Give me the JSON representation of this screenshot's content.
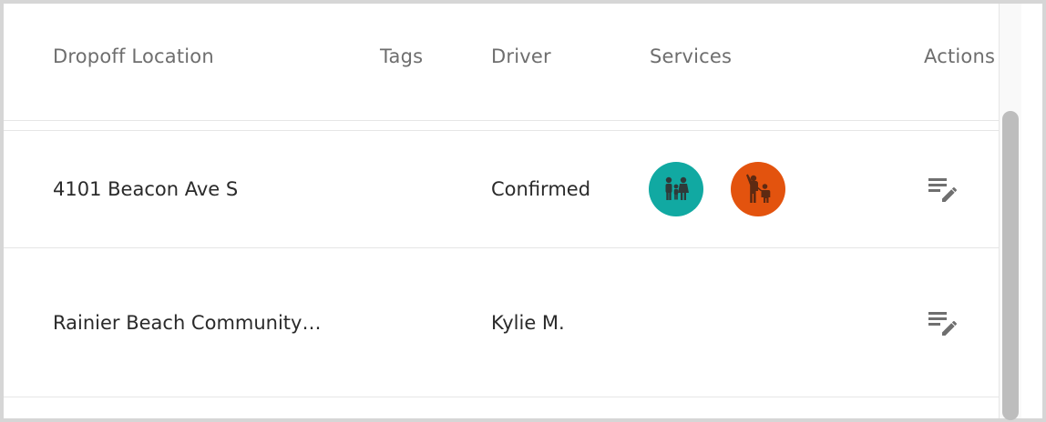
{
  "columns": {
    "dropoff": "Dropoff Location",
    "tags": "Tags",
    "driver": "Driver",
    "services": "Services",
    "actions": "Actions"
  },
  "rows": [
    {
      "dropoff": "4101 Beacon Ave S",
      "tags": "",
      "driver": "Confirmed",
      "services": [
        {
          "icon": "family-icon",
          "color": "#11a9a2"
        },
        {
          "icon": "parent-child-icon",
          "color": "#e3530e"
        }
      ],
      "action_icon": "edit-note-icon"
    },
    {
      "dropoff": "Rainier Beach Community…",
      "tags": "",
      "driver": "Kylie M.",
      "services": [],
      "action_icon": "edit-note-icon"
    }
  ],
  "colors": {
    "teal": "#11a9a2",
    "orange": "#e3530e",
    "icon_dark": "#5e2a12",
    "action_icon": "#6f6f6f"
  }
}
